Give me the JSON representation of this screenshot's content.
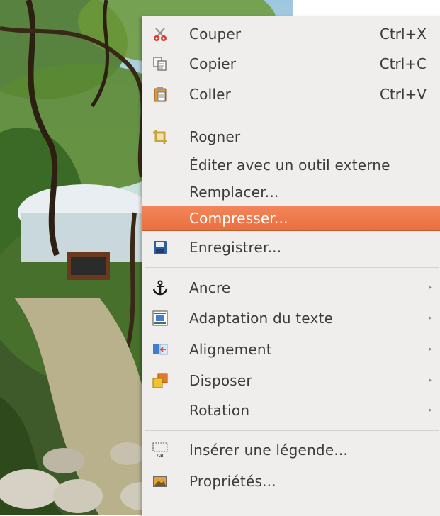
{
  "menu": {
    "items": [
      {
        "label": "Couper",
        "shortcut": "Ctrl+X",
        "icon": "scissors-icon"
      },
      {
        "label": "Copier",
        "shortcut": "Ctrl+C",
        "icon": "copy-icon"
      },
      {
        "label": "Coller",
        "shortcut": "Ctrl+V",
        "icon": "paste-icon"
      },
      {
        "label": "Rogner",
        "icon": "crop-icon"
      },
      {
        "label": "Éditer avec un outil externe"
      },
      {
        "label": "Remplacer..."
      },
      {
        "label": "Compresser...",
        "highlighted": true
      },
      {
        "label": "Enregistrer...",
        "icon": "save-icon"
      },
      {
        "label": "Ancre",
        "icon": "anchor-icon",
        "submenu": true
      },
      {
        "label": "Adaptation du texte",
        "icon": "text-wrap-icon",
        "submenu": true
      },
      {
        "label": "Alignement",
        "icon": "alignment-icon",
        "submenu": true
      },
      {
        "label": "Disposer",
        "icon": "arrange-icon",
        "submenu": true
      },
      {
        "label": "Rotation",
        "submenu": true
      },
      {
        "label": "Insérer une légende...",
        "icon": "caption-icon"
      },
      {
        "label": "Propriétés...",
        "icon": "properties-icon"
      }
    ],
    "submenu_arrow": "▸"
  },
  "colors": {
    "menu_bg": "#efeeec",
    "highlight": "#ec7546",
    "text": "#3c3c3c"
  }
}
